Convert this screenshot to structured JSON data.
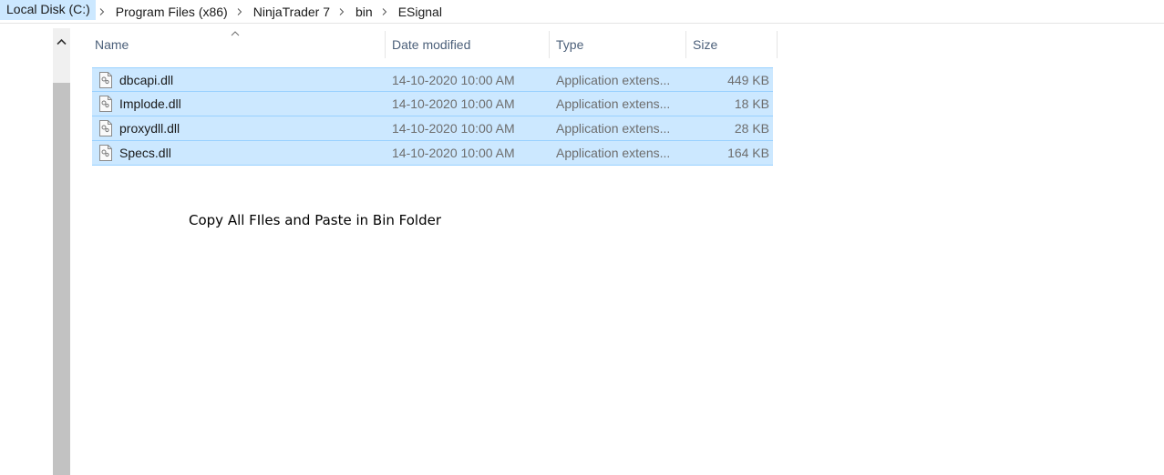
{
  "breadcrumb": {
    "items": [
      "Local Disk (C:)",
      "Program Files (x86)",
      "NinjaTrader 7",
      "bin",
      "ESignal"
    ]
  },
  "columns": {
    "name": "Name",
    "date": "Date modified",
    "type": "Type",
    "size": "Size"
  },
  "files": [
    {
      "name": "dbcapi.dll",
      "date": "14-10-2020 10:00 AM",
      "type": "Application extens...",
      "size": "449 KB"
    },
    {
      "name": "Implode.dll",
      "date": "14-10-2020 10:00 AM",
      "type": "Application extens...",
      "size": "18 KB"
    },
    {
      "name": "proxydll.dll",
      "date": "14-10-2020 10:00 AM",
      "type": "Application extens...",
      "size": "28 KB"
    },
    {
      "name": "Specs.dll",
      "date": "14-10-2020 10:00 AM",
      "type": "Application extens...",
      "size": "164 KB"
    }
  ],
  "instruction": "Copy All FIles and Paste in Bin Folder",
  "colors": {
    "selection": "#cce8ff",
    "selection_border": "#99d1ff",
    "header_text": "#4c607a"
  }
}
